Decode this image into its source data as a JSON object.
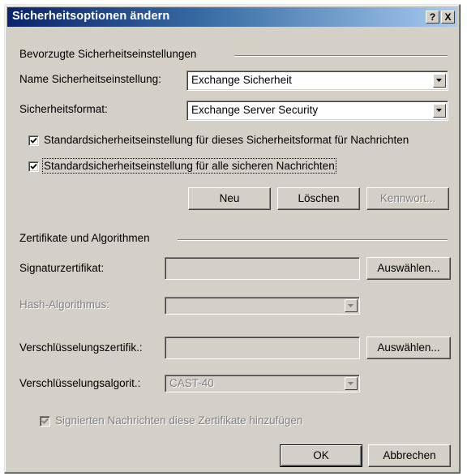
{
  "dialog": {
    "title": "Sicherheitsoptionen ändern",
    "help_button": "?",
    "close_button": "X"
  },
  "preferred": {
    "group_label": "Bevorzugte Sicherheitseinstellungen",
    "name_label": "Name Sicherheitseinstellung:",
    "name_value": "Exchange Sicherheit",
    "format_label": "Sicherheitsformat:",
    "format_value": "Exchange Server Security",
    "default_for_format_label": "Standardsicherheitseinstellung für dieses Sicherheitsformat für Nachrichten",
    "default_for_format_checked": true,
    "default_for_all_label": "Standardsicherheitseinstellung für alle sicheren Nachrichten",
    "default_for_all_checked": true,
    "new_button": "Neu",
    "delete_button": "Löschen",
    "password_button": "Kennwort..."
  },
  "certificates": {
    "group_label": "Zertifikate und Algorithmen",
    "signing_cert_label": "Signaturzertifikat:",
    "signing_cert_value": "",
    "signing_choose_button": "Auswählen...",
    "hash_label": "Hash-Algorithmus:",
    "hash_value": "",
    "encryption_cert_label": "Verschlüsselungszertifik.:",
    "encryption_cert_value": "",
    "encryption_choose_button": "Auswählen...",
    "encryption_algo_label": "Verschlüsselungsalgorit.:",
    "encryption_algo_value": "CAST-40",
    "send_certs_label": "Signierten Nachrichten diese Zertifikate hinzufügen",
    "send_certs_checked": true
  },
  "footer": {
    "ok_button": "OK",
    "cancel_button": "Abbrechen"
  }
}
